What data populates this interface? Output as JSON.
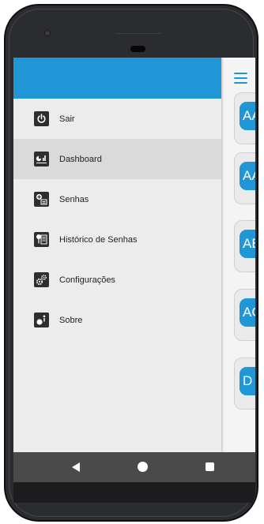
{
  "drawer": {
    "items": [
      {
        "label": "Sair",
        "icon": "power-icon"
      },
      {
        "label": "Dashboard",
        "icon": "dashboard-icon",
        "active": true
      },
      {
        "label": "Senhas",
        "icon": "add-ticket-icon"
      },
      {
        "label": "Histórico de Senhas",
        "icon": "history-icon"
      },
      {
        "label": "Configurações",
        "icon": "gears-icon"
      },
      {
        "label": "Sobre",
        "icon": "about-icon"
      }
    ]
  },
  "content": {
    "cards": [
      {
        "badge": "AA/"
      },
      {
        "badge": "AAI"
      },
      {
        "badge": "AB/"
      },
      {
        "badge": "AC"
      },
      {
        "badge": "D"
      }
    ]
  },
  "colors": {
    "accent": "#2196d6",
    "drawer_bg": "#ececec",
    "active_item": "#dadada",
    "navbar": "#4a4a4a"
  }
}
